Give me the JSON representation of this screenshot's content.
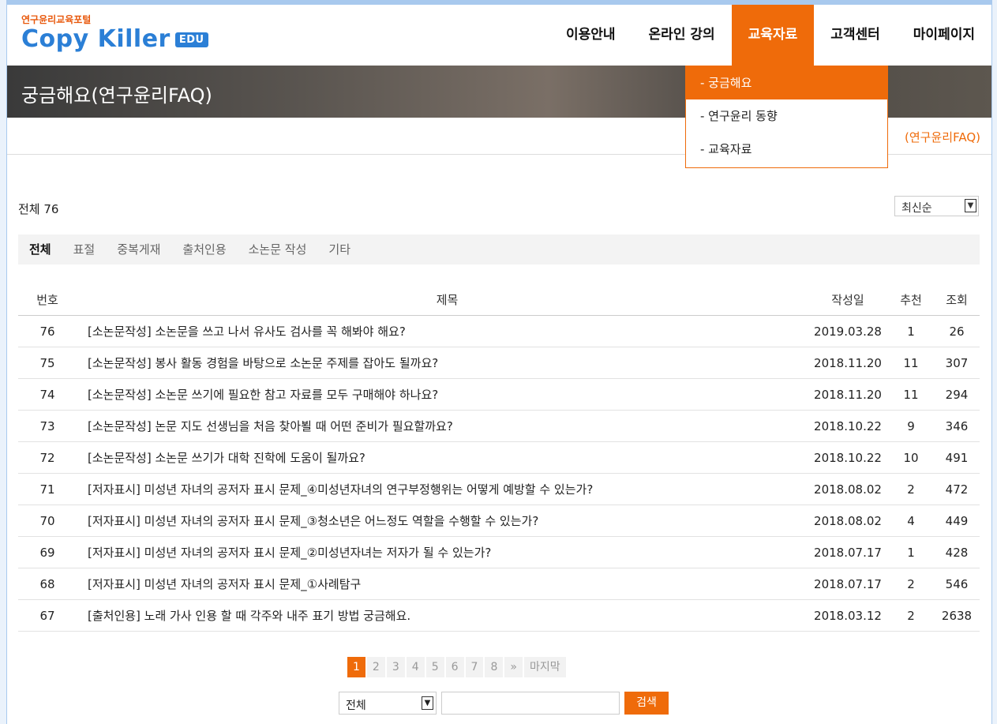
{
  "header": {
    "logo_small": "연구윤리교육포털",
    "logo_main": "Copy Killer",
    "logo_edu": "EDU",
    "nav": [
      {
        "label": "이용안내"
      },
      {
        "label": "온라인 강의"
      },
      {
        "label": "교육자료"
      },
      {
        "label": "고객센터"
      },
      {
        "label": "마이페이지"
      }
    ]
  },
  "dropdown": [
    {
      "label": "- 궁금해요"
    },
    {
      "label": "- 연구윤리 동향"
    },
    {
      "label": "- 교육자료"
    }
  ],
  "banner": {
    "title": "궁금해요(연구윤리FAQ)"
  },
  "breadcrumb": {
    "current": "(연구윤리FAQ)"
  },
  "list": {
    "total_label": "전체 76",
    "sort_value": "최신순",
    "tabs": [
      {
        "label": "전체"
      },
      {
        "label": "표절"
      },
      {
        "label": "중복게재"
      },
      {
        "label": "출처인용"
      },
      {
        "label": "소논문 작성"
      },
      {
        "label": "기타"
      }
    ],
    "columns": {
      "no": "번호",
      "title": "제목",
      "date": "작성일",
      "rec": "추천",
      "views": "조회"
    },
    "rows": [
      {
        "no": "76",
        "title": "[소논문작성] 소논문을 쓰고 나서 유사도 검사를 꼭 해봐야 해요?",
        "date": "2019.03.28",
        "rec": "1",
        "views": "26"
      },
      {
        "no": "75",
        "title": "[소논문작성] 봉사 활동 경험을 바탕으로 소논문 주제를 잡아도 될까요?",
        "date": "2018.11.20",
        "rec": "11",
        "views": "307"
      },
      {
        "no": "74",
        "title": "[소논문작성] 소논문 쓰기에 필요한 참고 자료를 모두 구매해야 하나요?",
        "date": "2018.11.20",
        "rec": "11",
        "views": "294"
      },
      {
        "no": "73",
        "title": "[소논문작성] 논문 지도 선생님을 처음 찾아뵐 때 어떤 준비가 필요할까요?",
        "date": "2018.10.22",
        "rec": "9",
        "views": "346"
      },
      {
        "no": "72",
        "title": "[소논문작성] 소논문 쓰기가 대학 진학에 도움이 될까요?",
        "date": "2018.10.22",
        "rec": "10",
        "views": "491"
      },
      {
        "no": "71",
        "title": "[저자표시] 미성년 자녀의 공저자 표시 문제_④미성년자녀의 연구부정행위는 어떻게 예방할 수 있는가?",
        "date": "2018.08.02",
        "rec": "2",
        "views": "472"
      },
      {
        "no": "70",
        "title": "[저자표시] 미성년 자녀의 공저자 표시 문제_③청소년은 어느정도 역할을 수행할 수 있는가?",
        "date": "2018.08.02",
        "rec": "4",
        "views": "449"
      },
      {
        "no": "69",
        "title": "[저자표시] 미성년 자녀의 공저자 표시 문제_②미성년자녀는 저자가 될 수 있는가?",
        "date": "2018.07.17",
        "rec": "1",
        "views": "428"
      },
      {
        "no": "68",
        "title": "[저자표시] 미성년 자녀의 공저자 표시 문제_①사례탐구",
        "date": "2018.07.17",
        "rec": "2",
        "views": "546"
      },
      {
        "no": "67",
        "title": "[출처인용] 노래 가사 인용 할 때 각주와 내주 표기 방법 궁금해요.",
        "date": "2018.03.12",
        "rec": "2",
        "views": "2638"
      }
    ]
  },
  "pagination": {
    "pages": [
      "1",
      "2",
      "3",
      "4",
      "5",
      "6",
      "7",
      "8",
      "»",
      "마지막"
    ],
    "current": "1"
  },
  "search": {
    "scope": "전체",
    "button": "검색",
    "input_value": ""
  },
  "colors": {
    "accent": "#ef6b0a",
    "brand_blue": "#2b7fd6"
  }
}
